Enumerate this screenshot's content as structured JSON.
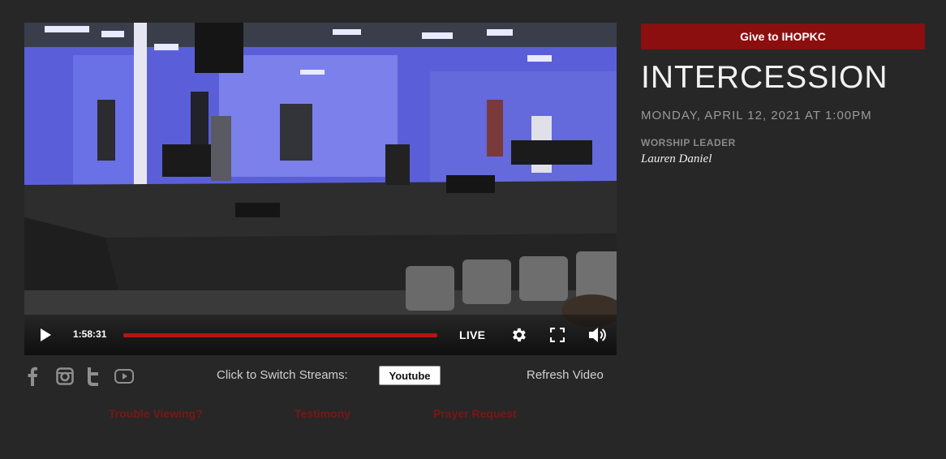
{
  "video": {
    "time": "1:58:31",
    "live_label": "LIVE",
    "progress": 1.0
  },
  "social_icons": [
    "facebook-icon",
    "instagram-icon",
    "twitter-icon",
    "youtube-icon"
  ],
  "stream_switch": {
    "label": "Click to Switch Streams:",
    "button": "Youtube"
  },
  "refresh_label": "Refresh Video",
  "links": {
    "trouble": "Trouble Viewing?",
    "testimony": "Testimony",
    "prayer": "Prayer Request"
  },
  "sidebar": {
    "give_button": "Give to IHOPKC",
    "title": "INTERCESSION",
    "date": "MONDAY, APRIL 12, 2021 AT 1:00PM",
    "leader_label": "WORSHIP LEADER",
    "leader_name": "Lauren Daniel"
  },
  "colors": {
    "background": "#272727",
    "accent": "#8b0f0f",
    "link": "#7a1616"
  }
}
